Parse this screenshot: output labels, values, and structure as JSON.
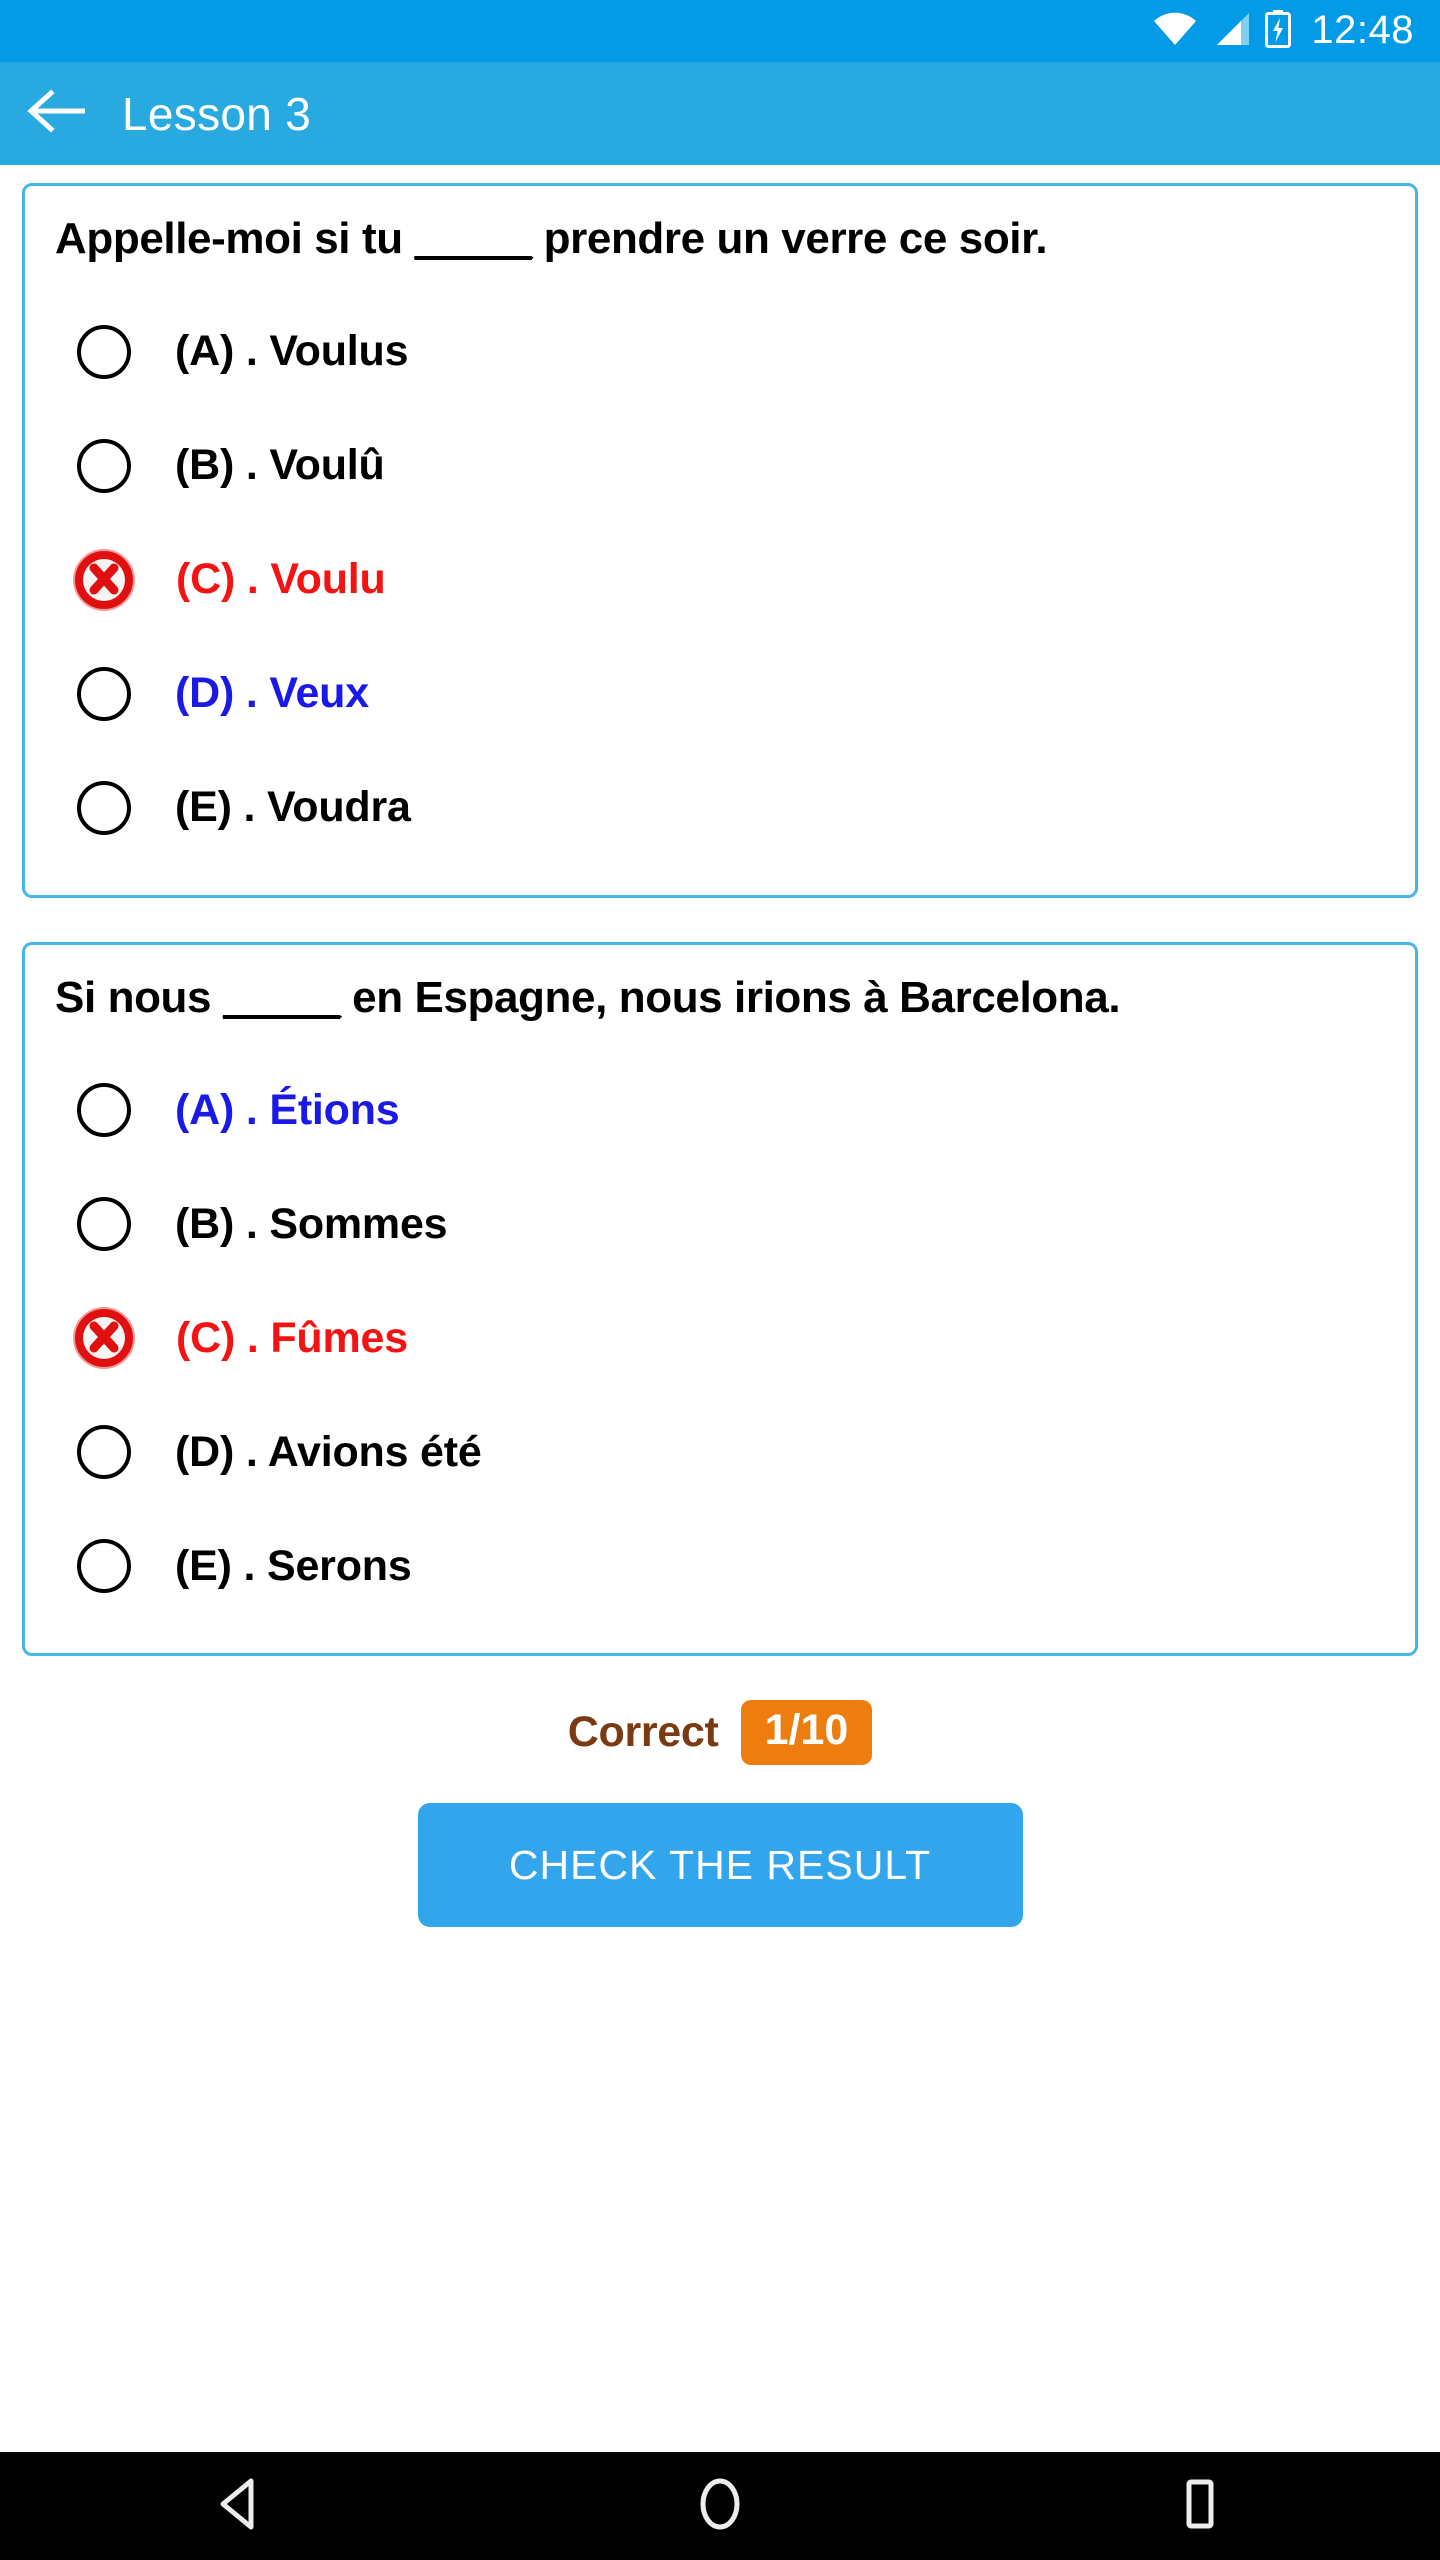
{
  "status_bar": {
    "time": "12:48",
    "icons": [
      "wifi-icon",
      "cellular-signal-icon",
      "battery-charging-icon"
    ],
    "background_color": "#039BE5"
  },
  "app_bar": {
    "back_icon": "back-arrow-icon",
    "title": "Lesson 3",
    "background_color": "#28AAE1"
  },
  "theme": {
    "card_border": "#45B6E6",
    "wrong_color": "#F41313",
    "correct_color": "#1A19E6",
    "accent_orange": "#ED7D0E",
    "score_text": "#7A3A12",
    "button_blue": "#33A5EC"
  },
  "questions": [
    {
      "prompt_before": "Appelle-moi si tu ",
      "prompt_blank": "_____",
      "prompt_after": " prendre un verre ce soir.",
      "options": [
        {
          "label": "(A) . Voulus",
          "state": "neutral"
        },
        {
          "label": "(B) . Voulû",
          "state": "neutral"
        },
        {
          "label": "(C) . Voulu",
          "state": "wrong"
        },
        {
          "label": "(D) . Veux",
          "state": "correct"
        },
        {
          "label": "(E) . Voudra",
          "state": "neutral"
        }
      ]
    },
    {
      "prompt_before": "Si nous ",
      "prompt_blank": "_____",
      "prompt_after": " en Espagne, nous irions à Barcelona.",
      "options": [
        {
          "label": "(A) . Étions",
          "state": "correct"
        },
        {
          "label": "(B) . Sommes",
          "state": "neutral"
        },
        {
          "label": "(C) . Fûmes",
          "state": "wrong"
        },
        {
          "label": "(D) . Avions été",
          "state": "neutral"
        },
        {
          "label": "(E) . Serons",
          "state": "neutral"
        }
      ]
    }
  ],
  "score": {
    "label": "Correct",
    "value": "1/10"
  },
  "action": {
    "check_label": "CHECK THE RESULT"
  },
  "nav_bar": {
    "items": [
      "back-triangle-icon",
      "home-circle-icon",
      "recents-square-icon"
    ]
  }
}
